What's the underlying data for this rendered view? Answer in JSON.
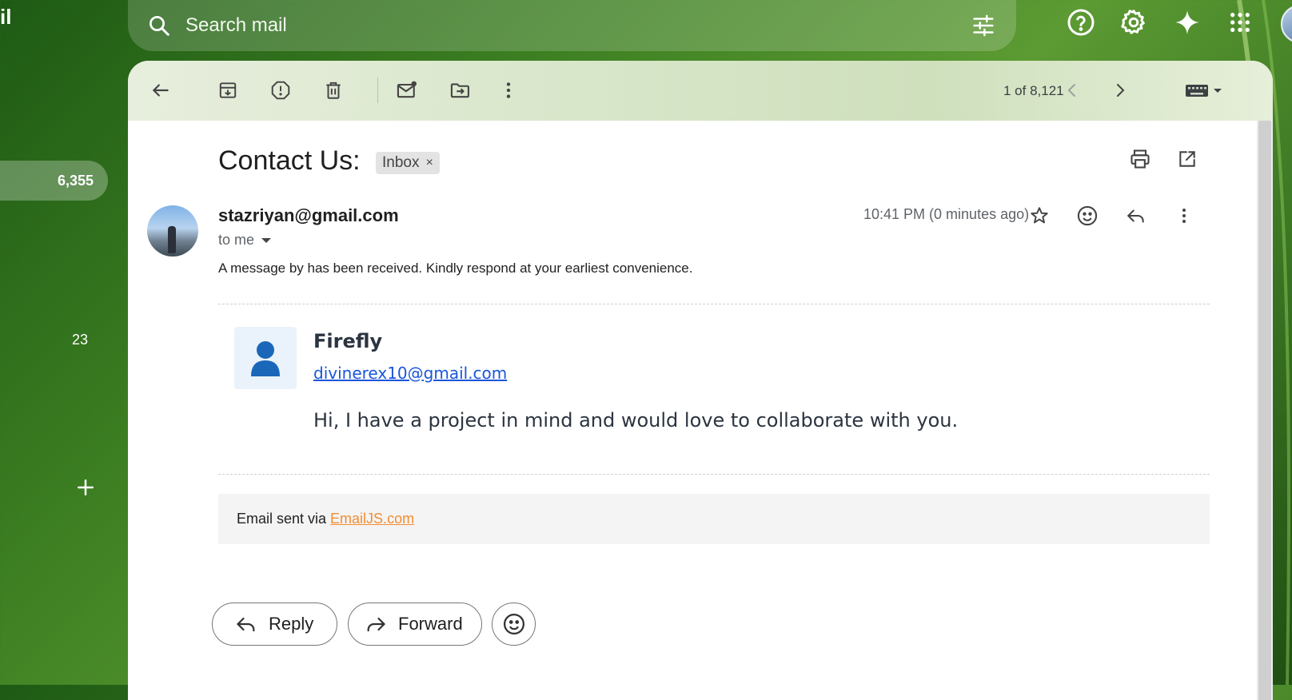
{
  "app": {
    "logo_text": "il"
  },
  "search": {
    "placeholder": "Search mail"
  },
  "nav": {
    "active_count": "6,355",
    "secondary_count": "23"
  },
  "toolbar": {
    "pager": "1 of 8,121"
  },
  "email": {
    "subject": "Contact Us:",
    "label": "Inbox",
    "label_remove": "×",
    "sender": "stazriyan@gmail.com",
    "recipient": "to me",
    "timestamp": "10:41 PM (0 minutes ago)",
    "snippet": "A message by has been received. Kindly respond at your earliest convenience.",
    "body": {
      "name": "Firefly",
      "email": "divinerex10@gmail.com",
      "message": "Hi, I have a project in mind and would love to collaborate with you."
    },
    "footer_prefix": "Email sent via ",
    "footer_link": "EmailJS.com"
  },
  "actions": {
    "reply": "Reply",
    "forward": "Forward"
  },
  "icons": [
    "search-icon",
    "filter-options-icon",
    "help-icon",
    "settings-gear-icon",
    "gemini-sparkle-icon",
    "apps-grid-icon",
    "back-arrow-icon",
    "archive-icon",
    "report-spam-icon",
    "delete-icon",
    "mark-unread-icon",
    "move-to-icon",
    "more-vert-icon",
    "chevron-left-icon",
    "chevron-right-icon",
    "keyboard-icon",
    "print-icon",
    "open-new-window-icon",
    "star-icon",
    "emoji-icon",
    "reply-icon",
    "forward-icon",
    "plus-icon",
    "person-icon"
  ]
}
